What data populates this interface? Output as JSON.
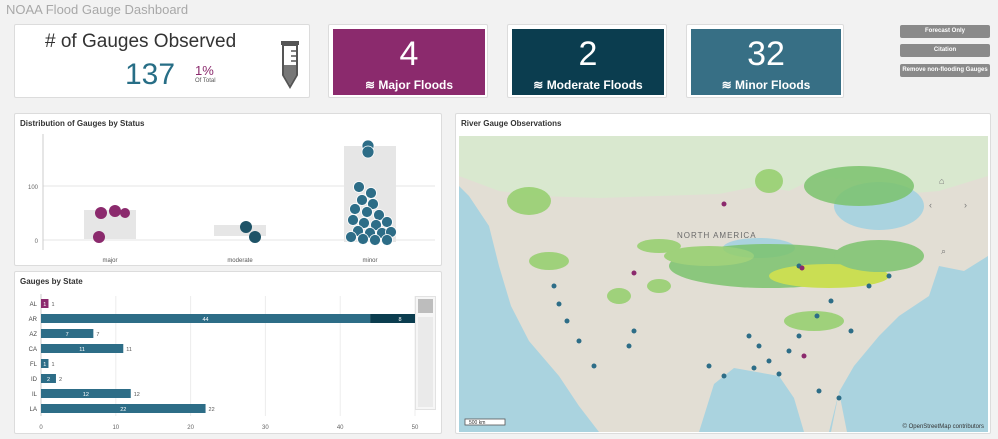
{
  "app": {
    "title": "NOAA Flood Gauge Dashboard"
  },
  "kpi": {
    "title": "# of Gauges Observed",
    "value": "137",
    "pct": "1%",
    "of_total": "Of Total"
  },
  "floods": [
    {
      "count": "4",
      "label": "Major Floods",
      "color": "#8b2a6d"
    },
    {
      "count": "2",
      "label": "Moderate Floods",
      "color": "#0b3d4f"
    },
    {
      "count": "32",
      "label": "Minor Floods",
      "color": "#376f85"
    }
  ],
  "buttons": [
    "Forecast Only",
    "Citation",
    "Remove non-flooding Gauges"
  ],
  "distribution": {
    "title": "Distribution of Gauges by Status",
    "chart_data": {
      "type": "scatter",
      "categories": [
        "major",
        "moderate",
        "minor"
      ],
      "y_ticks": [
        "0",
        "100"
      ],
      "colors": {
        "major": "#8b2a6d",
        "moderate": "#1e5367",
        "minor": "#2d6d87"
      }
    }
  },
  "states": {
    "title": "Gauges by State",
    "chart_data": {
      "type": "bar",
      "categories": [
        "AL",
        "AR",
        "AZ",
        "CA",
        "FL",
        "ID",
        "IL",
        "LA"
      ],
      "series": [
        {
          "values": [
            1,
            0,
            0,
            0,
            0,
            0,
            0,
            0
          ],
          "color": "#8b2a6d"
        },
        {
          "values": [
            0,
            8,
            0,
            0,
            0,
            0,
            0,
            0
          ],
          "color": "#0b3d4f"
        },
        {
          "values": [
            0,
            44,
            7,
            11,
            1,
            2,
            12,
            22
          ],
          "color": "#2d6d87"
        }
      ],
      "totals": [
        1,
        50,
        7,
        11,
        1,
        2,
        12,
        22
      ],
      "x_ticks": [
        "0",
        "10",
        "20",
        "30",
        "40",
        "50"
      ],
      "xlim": [
        0,
        50
      ]
    }
  },
  "map": {
    "title": "River Gauge Observations",
    "region_label": "NORTH AMERICA",
    "scale": "500 km",
    "attribution": "© OpenStreetMap contributors"
  }
}
